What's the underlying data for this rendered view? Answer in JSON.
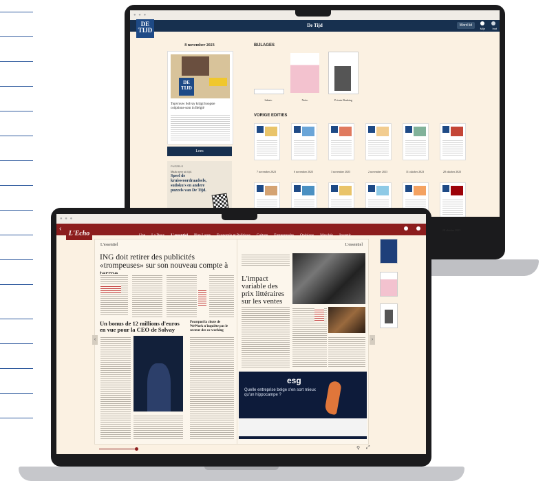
{
  "back_app": {
    "nav_title": "De Tijd",
    "logo": "DE TIJD",
    "button": "Word lid",
    "icon_labels": [
      "Mijn",
      "Inst"
    ],
    "edition": {
      "date": "8 november 2023",
      "headline": "Topvrouw Solvay krijgt hoogste coöptions-som in België",
      "read_button": "Lees"
    },
    "puzzle": {
      "tag": "PUZZELS",
      "sub": "Maak meer uit tijd.",
      "title": "Speel de kruiswoordraadsels, sudoku's en andere puzzels van De Tijd."
    },
    "bijlagen": {
      "heading": "BIJLAGES",
      "items": [
        "Sabato",
        "Netto",
        "Private Banking"
      ]
    },
    "vorige": {
      "heading": "VORIGE EDITIES",
      "dates": [
        "7 november 2023",
        "6 november 2023",
        "3 november 2023",
        "2 november 2023",
        "31 oktober 2023",
        "28 oktober 2023"
      ],
      "extra_date": "28 oktober 2023"
    }
  },
  "front_app": {
    "logo": "L'Echo",
    "nav": [
      "Une",
      "La Deux",
      "L'essentiel",
      "Plan Large",
      "Economie et Politique",
      "Culture",
      "Entreprendre",
      "Opinions",
      "Marchés",
      "Investir"
    ],
    "active_nav": "L'essentiel",
    "left_page": {
      "section": "L'essentiel",
      "headline": "ING doit retirer des publicités «trompeuses» sur son nouveau compte à terme",
      "sub_headline": "Un bonus de 12 millions d'euros en vue pour la CEO de Solvay",
      "side_headline": "Pourquoi la chute de WeWork n'inquiète pas le secteur des co-working"
    },
    "right_page": {
      "section": "L'essentiel",
      "headline": "L'impact variable des prix littéraires sur les ventes"
    },
    "ad": {
      "brand": "esg",
      "question": "Quelle entreprise belge s'en sort mieux qu'un hippocampe ?"
    }
  }
}
